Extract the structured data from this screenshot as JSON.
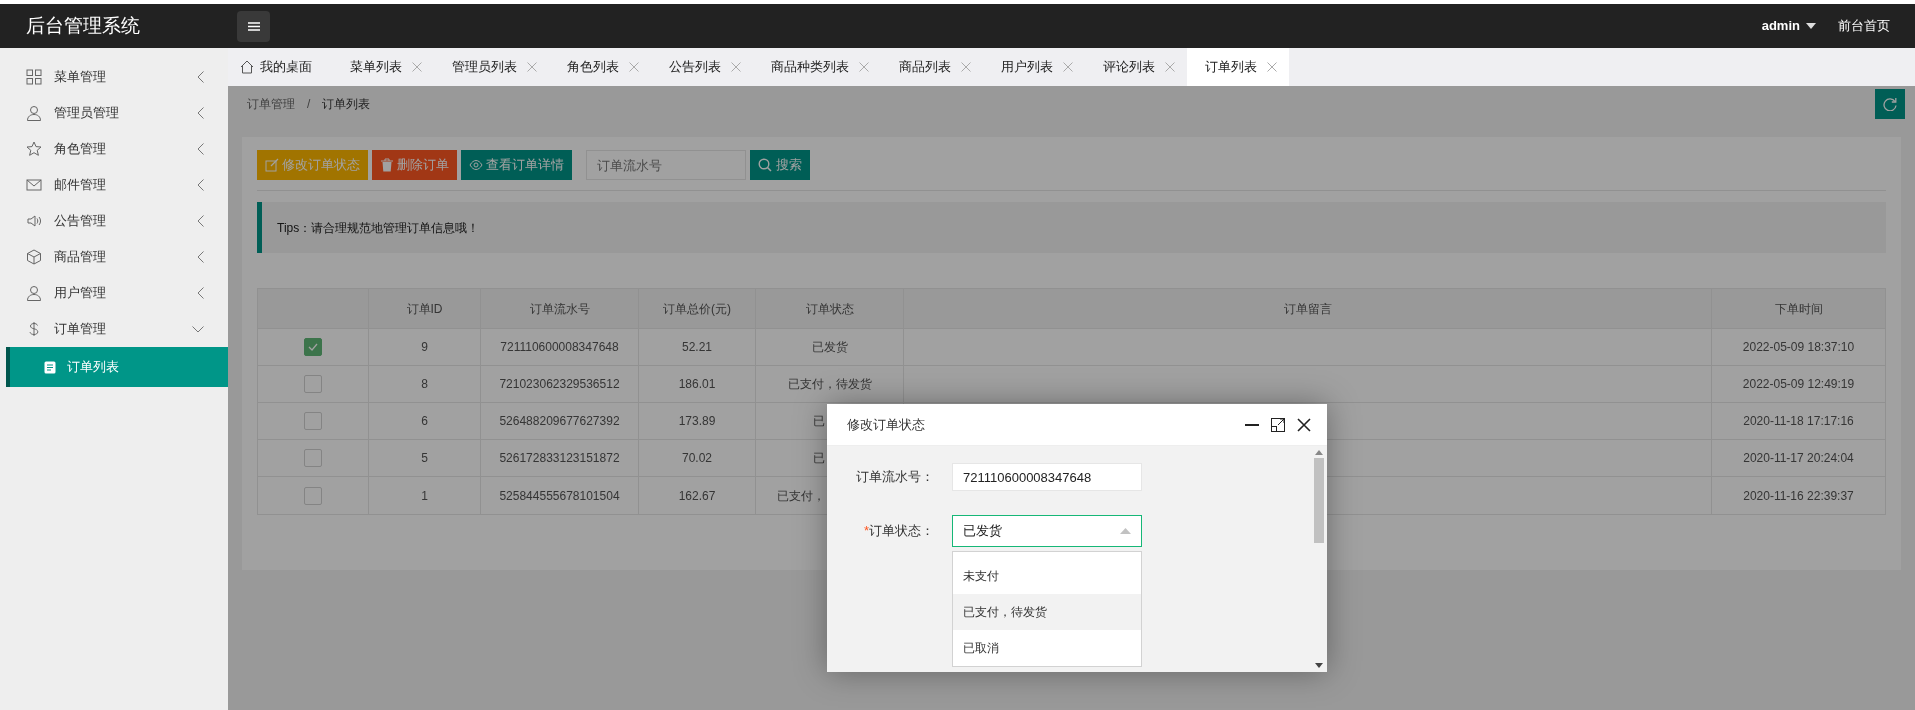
{
  "app_title": "后台管理系统",
  "topbar": {
    "user": "admin",
    "home_link": "前台首页"
  },
  "sidebar": {
    "items": [
      {
        "label": "菜单管理",
        "expanded": false
      },
      {
        "label": "管理员管理",
        "expanded": false
      },
      {
        "label": "角色管理",
        "expanded": false
      },
      {
        "label": "邮件管理",
        "expanded": false
      },
      {
        "label": "公告管理",
        "expanded": false
      },
      {
        "label": "商品管理",
        "expanded": false
      },
      {
        "label": "用户管理",
        "expanded": false
      },
      {
        "label": "订单管理",
        "expanded": true,
        "children": [
          {
            "label": "订单列表",
            "selected": true
          }
        ]
      }
    ]
  },
  "tabs": [
    {
      "label": "我的桌面",
      "kind": "home",
      "selected": false
    },
    {
      "label": "菜单列表",
      "kind": "page",
      "selected": false
    },
    {
      "label": "管理员列表",
      "kind": "page",
      "selected": false
    },
    {
      "label": "角色列表",
      "kind": "page",
      "selected": false
    },
    {
      "label": "公告列表",
      "kind": "page",
      "selected": false
    },
    {
      "label": "商品种类列表",
      "kind": "page",
      "selected": false
    },
    {
      "label": "商品列表",
      "kind": "page",
      "selected": false
    },
    {
      "label": "用户列表",
      "kind": "page",
      "selected": false
    },
    {
      "label": "评论列表",
      "kind": "page",
      "selected": false
    },
    {
      "label": "订单列表",
      "kind": "page",
      "selected": true
    }
  ],
  "breadcrumb": {
    "items": [
      "订单管理",
      "订单列表"
    ],
    "separator": "/"
  },
  "toolbar": {
    "buttons": [
      {
        "label": "修改订单状态",
        "kind": "warning"
      },
      {
        "label": "删除订单",
        "kind": "danger"
      },
      {
        "label": "查看订单详情",
        "kind": "primary"
      }
    ],
    "search": {
      "placeholder": "订单流水号"
    },
    "search_button": "搜索"
  },
  "tips": "Tips：请合理规范地管理订单信息哦！",
  "table": {
    "columns": [
      "订单ID",
      "订单流水号",
      "订单总价(元)",
      "订单状态",
      "订单留言",
      "下单时间"
    ],
    "rows": [
      {
        "checked": true,
        "id": "9",
        "serial": "721110600008347648",
        "total": "52.21",
        "status": "已发货",
        "status_cut_off": false,
        "time": "2022-05-09 18:37:10"
      },
      {
        "checked": false,
        "id": "8",
        "serial": "721023062329536512",
        "total": "186.01",
        "status": "已支付，待发货",
        "status_cut_off": false,
        "time": "2022-05-09 12:49:19"
      },
      {
        "checked": false,
        "id": "6",
        "serial": "526488209677627392",
        "total": "173.89",
        "status": "已",
        "status_cut_off": true,
        "time": "2020-11-18 17:17:16"
      },
      {
        "checked": false,
        "id": "5",
        "serial": "526172833123151872",
        "total": "70.02",
        "status": "已",
        "status_cut_off": true,
        "time": "2020-11-17 20:24:04"
      },
      {
        "checked": false,
        "id": "1",
        "serial": "525844555678101504",
        "total": "162.67",
        "status": "已支付，",
        "status_cut_off": true,
        "time": "2020-11-16 22:39:37"
      }
    ]
  },
  "dialog": {
    "title": "修改订单状态",
    "serial_field": {
      "label": "订单流水号：",
      "value": "721110600008347648"
    },
    "status_field": {
      "label": "订单状态：",
      "required_mark": "*",
      "value": "已发货",
      "expanded": true,
      "options": [
        {
          "label": "未支付",
          "highlighted": false
        },
        {
          "label": "已支付，待发货",
          "highlighted": true
        },
        {
          "label": "已取消",
          "highlighted": false
        }
      ]
    }
  }
}
